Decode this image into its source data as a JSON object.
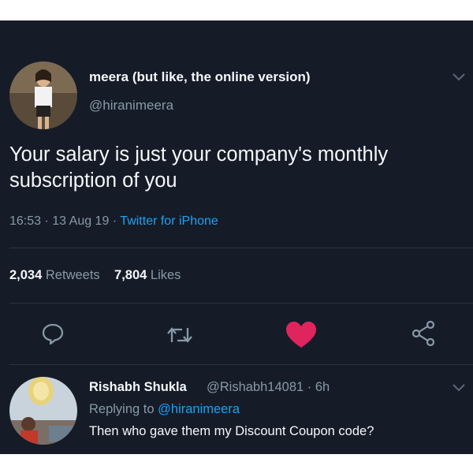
{
  "tweet": {
    "display_name": "meera (but like, the online version)",
    "handle": "@hiranimeera",
    "text": "Your salary is just your company's monthly subscription of you",
    "time": "16:53",
    "date": "13 Aug 19",
    "source": "Twitter for iPhone",
    "retweets": "2,034",
    "retweets_label": "Retweets",
    "likes": "7,804",
    "likes_label": "Likes",
    "liked": true
  },
  "actions": [
    "reply-icon",
    "retweet-icon",
    "like-icon",
    "share-icon"
  ],
  "reply": {
    "display_name": "Rishabh Shukla",
    "handle": "@Rishabh14081",
    "age": "6h",
    "replying_prefix": "Replying to",
    "replying_to": "@hiranimeera",
    "text": "Then who gave them my Discount Coupon code?"
  },
  "colors": {
    "background": "#151c28",
    "text": "#f5f7fa",
    "muted": "#8899a6",
    "link": "#1da1f2",
    "like": "#e0245e"
  }
}
